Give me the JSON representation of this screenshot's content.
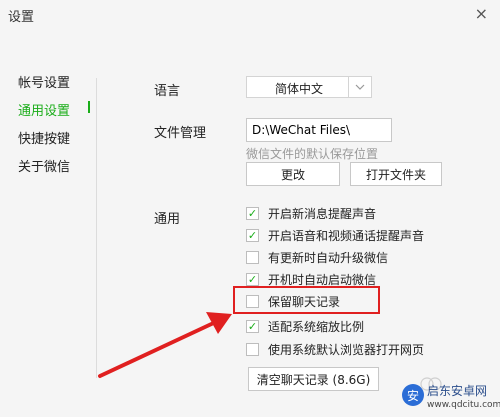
{
  "window": {
    "title": "设置",
    "close_glyph": "×"
  },
  "sidebar": {
    "items": [
      {
        "label": "帐号设置"
      },
      {
        "label": "通用设置"
      },
      {
        "label": "快捷按键"
      },
      {
        "label": "关于微信"
      }
    ],
    "active_index": 1
  },
  "language": {
    "label": "语言",
    "value": "简体中文"
  },
  "file_management": {
    "label": "文件管理",
    "path": "D:\\WeChat Files\\",
    "hint": "微信文件的默认保存位置",
    "change_label": "更改",
    "open_folder_label": "打开文件夹"
  },
  "general": {
    "label": "通用",
    "options": [
      {
        "label": "开启新消息提醒声音",
        "checked": true
      },
      {
        "label": "开启语音和视频通话提醒声音",
        "checked": true
      },
      {
        "label": "有更新时自动升级微信",
        "checked": false
      },
      {
        "label": "开机时自动启动微信",
        "checked": true
      },
      {
        "label": "保留聊天记录",
        "checked": false
      },
      {
        "label": "适配系统缩放比例",
        "checked": true
      },
      {
        "label": "使用系统默认浏览器打开网页",
        "checked": false
      }
    ]
  },
  "clear_history_label": "清空聊天记录 (8.6G)",
  "watermark": {
    "title": "启东安卓网",
    "url": "www.qdcitu.com"
  },
  "colors": {
    "accent": "#1aad19",
    "annotation": "#e02020"
  }
}
